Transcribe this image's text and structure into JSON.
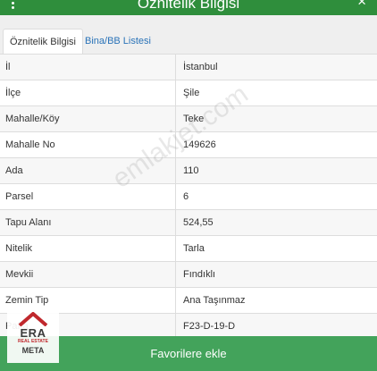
{
  "header": {
    "title": "Öznitelik Bilgisi",
    "close_symbol": "×"
  },
  "tabs": [
    {
      "label": "Öznitelik Bilgisi",
      "active": true
    },
    {
      "label": "Bina/BB Listesi",
      "active": false
    }
  ],
  "rows": [
    {
      "key": "İl",
      "value": "İstanbul"
    },
    {
      "key": "İlçe",
      "value": "Şile"
    },
    {
      "key": "Mahalle/Köy",
      "value": "Teke"
    },
    {
      "key": "Mahalle No",
      "value": "149626"
    },
    {
      "key": "Ada",
      "value": "110"
    },
    {
      "key": "Parsel",
      "value": "6"
    },
    {
      "key": "Tapu Alanı",
      "value": "524,55"
    },
    {
      "key": "Nitelik",
      "value": "Tarla"
    },
    {
      "key": "Mevkii",
      "value": "Fındıklı"
    },
    {
      "key": "Zemin Tip",
      "value": "Ana Taşınmaz"
    },
    {
      "key": "Pafta",
      "value": "F23-D-19-D"
    }
  ],
  "footer": {
    "button_label": "Favorilere ekle"
  },
  "watermark": {
    "text": "emlakjet.com"
  },
  "logo": {
    "line1": "ERA",
    "line2": "REAL ESTATE",
    "line3": "META"
  },
  "colors": {
    "header": "#2f8e3c",
    "button": "#43a35b",
    "link": "#2a73b8",
    "logo_red": "#c0282d"
  }
}
